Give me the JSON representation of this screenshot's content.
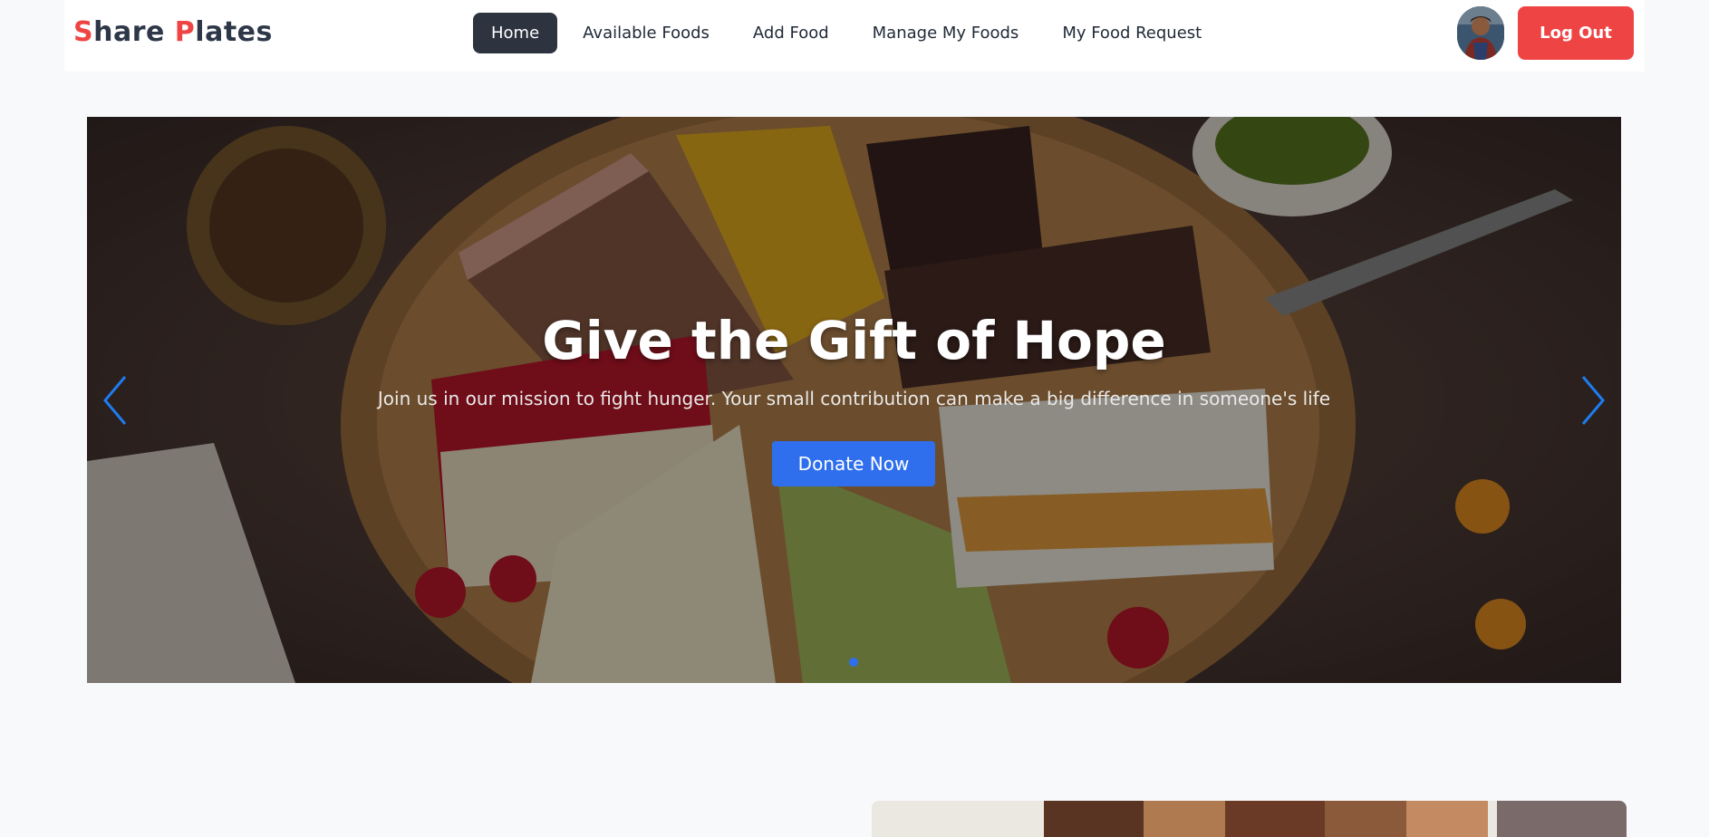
{
  "brand": {
    "letter1": "S",
    "rest1": "hare ",
    "letter2": "P",
    "rest2": "lates"
  },
  "nav": {
    "items": [
      {
        "label": "Home",
        "active": true
      },
      {
        "label": "Available Foods"
      },
      {
        "label": "Add Food"
      },
      {
        "label": "Manage My Foods"
      },
      {
        "label": "My Food Request"
      }
    ],
    "logout_label": "Log Out"
  },
  "hero": {
    "title": "Give the Gift of Hope",
    "subtitle": "Join us in our mission to fight hunger. Your small contribution can make a big difference in someone's life",
    "cta_label": "Donate Now"
  },
  "icons": {
    "prev": "chevron-left-icon",
    "next": "chevron-right-icon"
  },
  "colors": {
    "accent_red": "#ef4444",
    "nav_active": "#2d3440",
    "cta_blue": "#2f6fed",
    "text_dark": "#2d3748"
  }
}
